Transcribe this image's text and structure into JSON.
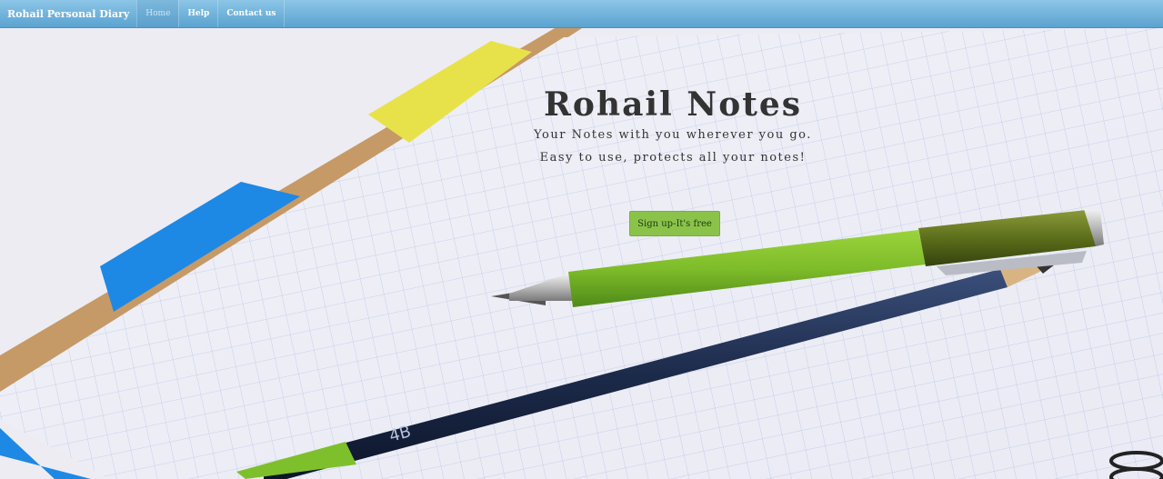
{
  "navbar": {
    "brand": "Rohail Personal Diary",
    "items": [
      {
        "label": "Home",
        "active": true
      },
      {
        "label": "Help",
        "active": false
      },
      {
        "label": "Contact us",
        "active": false
      }
    ]
  },
  "hero": {
    "title": "Rohail Notes",
    "subtitle": "Your Notes with you wherever you go.",
    "tagline": "Easy to use, protects all your notes!",
    "signup_label": "Sign up-It's free"
  },
  "colors": {
    "navbar": "#6eb2dc",
    "signup_button": "#8bc34a",
    "tab_blue": "#1e88e5",
    "tab_yellow": "#e8e24a",
    "pen_green": "#7ec02c",
    "pencil_navy": "#1c2a4a"
  },
  "icons": {
    "background": "notebook-with-pen-and-pencil-photo"
  }
}
